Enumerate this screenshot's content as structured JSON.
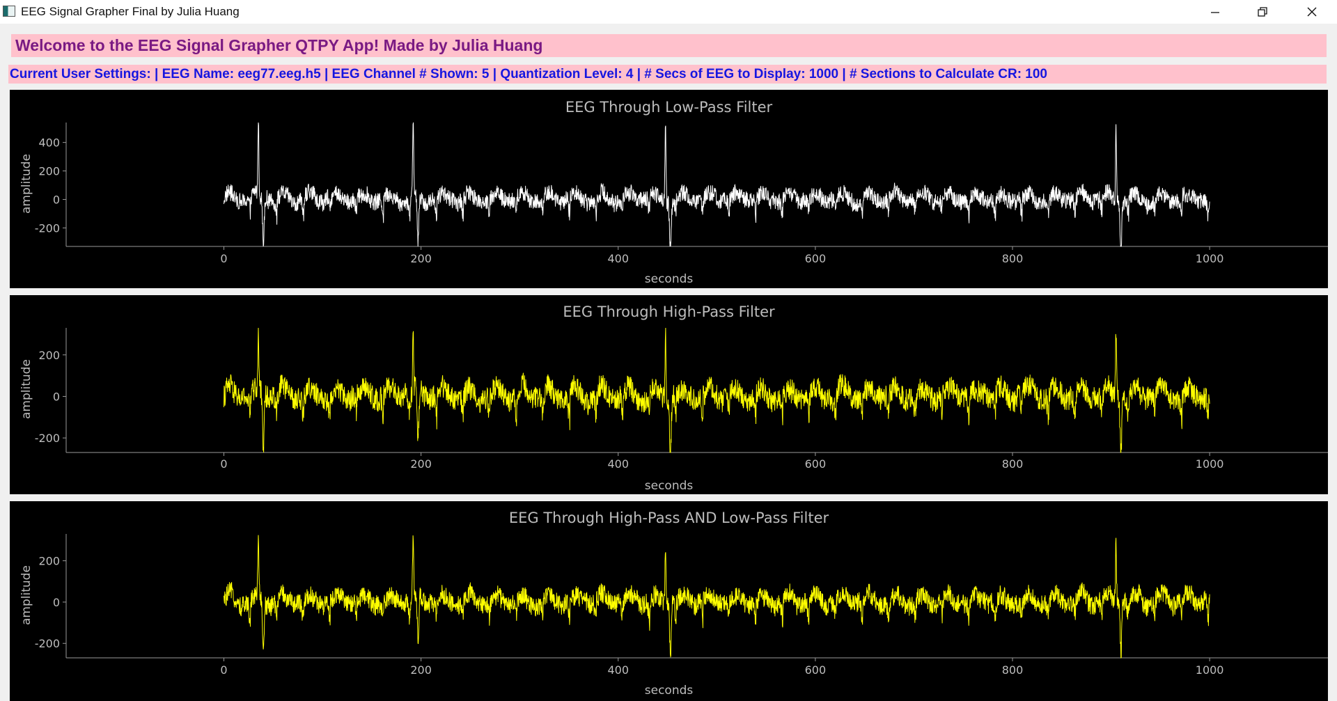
{
  "window": {
    "title": "EEG Signal Grapher Final by Julia Huang",
    "app_icon": "app-window-icon",
    "controls": [
      "minimize-icon",
      "restore-icon",
      "close-icon"
    ]
  },
  "header": {
    "welcome": "Welcome to the EEG Signal Grapher QTPY App! Made by Julia Huang",
    "settings": "Current User Settings: | EEG Name: eeg77.eeg.h5 | EEG Channel # Shown: 5 | Quantization Level: 4 | # Secs of EEG to Display: 1000 | # Sections to Calculate CR: 100"
  },
  "colors": {
    "header_bg": "#ffc1cc",
    "welcome_text": "#7a1a83",
    "settings_text": "#1616e0",
    "plot_bg": "#000000",
    "axis_text": "#bdbdbd",
    "lowpass_trace": "#ffffff",
    "highpass_trace": "#ffff00"
  },
  "chart_data": [
    {
      "type": "line",
      "title": "EEG Through Low-Pass Filter",
      "xlabel": "seconds",
      "ylabel": "amplitude",
      "xlim": [
        -160,
        1120
      ],
      "ylim": [
        -330,
        540
      ],
      "xticks": [
        "0",
        "200",
        "400",
        "600",
        "800",
        "1000"
      ],
      "yticks": [
        "400",
        "200",
        "0",
        "-200"
      ],
      "color": "#ffffff",
      "x_range": [
        0,
        1000
      ],
      "spikes_x": [
        35,
        192,
        448,
        905
      ],
      "baseline_amplitude": 70,
      "legend": "none",
      "grid": false
    },
    {
      "type": "line",
      "title": "EEG Through High-Pass Filter",
      "xlabel": "seconds",
      "ylabel": "amplitude",
      "xlim": [
        -160,
        1120
      ],
      "ylim": [
        -270,
        330
      ],
      "xticks": [
        "0",
        "200",
        "400",
        "600",
        "800",
        "1000"
      ],
      "yticks": [
        "200",
        "0",
        "-200"
      ],
      "color": "#ffff00",
      "x_range": [
        0,
        1000
      ],
      "spikes_x": [
        35,
        192,
        448,
        905
      ],
      "baseline_amplitude": 65,
      "legend": "none",
      "grid": false
    },
    {
      "type": "line",
      "title": "EEG Through High-Pass AND Low-Pass Filter",
      "xlabel": "seconds",
      "ylabel": "amplitude",
      "xlim": [
        -160,
        1120
      ],
      "ylim": [
        -270,
        330
      ],
      "xticks": [
        "0",
        "200",
        "400",
        "600",
        "800",
        "1000"
      ],
      "yticks": [
        "200",
        "0",
        "-200"
      ],
      "color": "#ffff00",
      "x_range": [
        0,
        1000
      ],
      "spikes_x": [
        35,
        192,
        448,
        905
      ],
      "baseline_amplitude": 55,
      "legend": "none",
      "grid": false
    }
  ]
}
